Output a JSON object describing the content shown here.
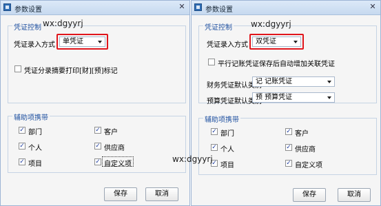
{
  "left": {
    "title": "参数设置",
    "close": "✕",
    "group1_title": "凭证控制",
    "entry_mode_label": "凭证录入方式",
    "entry_mode_value": "单凭证",
    "print_option": "凭证分录摘要打印[财][预]标记",
    "print_option_checked": false,
    "group2_title": "辅助项携带",
    "items": [
      {
        "label": "部门",
        "checked": true
      },
      {
        "label": "客户",
        "checked": true
      },
      {
        "label": "个人",
        "checked": true
      },
      {
        "label": "供应商",
        "checked": true
      },
      {
        "label": "项目",
        "checked": true
      },
      {
        "label": "自定义项",
        "checked": true
      }
    ],
    "save": "保存",
    "cancel": "取消"
  },
  "right": {
    "title": "参数设置",
    "close": "✕",
    "group1_title": "凭证控制",
    "entry_mode_label": "凭证录入方式",
    "entry_mode_value": "双凭证",
    "parallel_option": "平行记账凭证保存后自动增加关联凭证",
    "parallel_option_checked": false,
    "fin_default_label": "财务凭证默认类别",
    "fin_default_value": "记 记账凭证",
    "budget_default_label": "预算凭证默认类别",
    "budget_default_value": "预 预算凭证",
    "group2_title": "辅助项携带",
    "items": [
      {
        "label": "部门",
        "checked": true
      },
      {
        "label": "客户",
        "checked": true
      },
      {
        "label": "个人",
        "checked": true
      },
      {
        "label": "供应商",
        "checked": true
      },
      {
        "label": "项目",
        "checked": true
      },
      {
        "label": "自定义项",
        "checked": true
      }
    ],
    "save": "保存",
    "cancel": "取消"
  },
  "watermark": "wx:dgyyrj",
  "check_glyph": "✓",
  "accent_red": "#e0151b",
  "group_title_color": "#1e50a0"
}
